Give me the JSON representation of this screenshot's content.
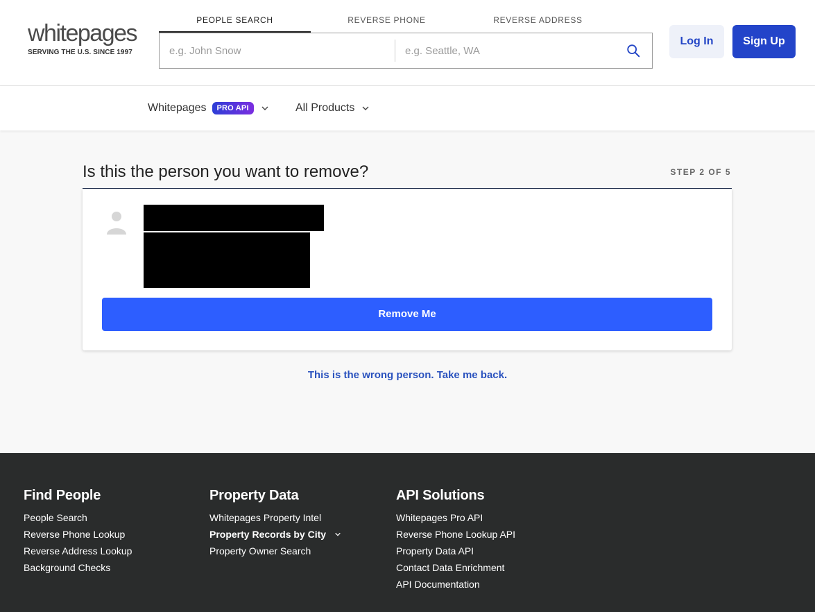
{
  "header": {
    "logo_text": "whitepages",
    "logo_tagline": "SERVING THE U.S. SINCE 1997",
    "tabs": [
      {
        "label": "PEOPLE SEARCH",
        "active": true
      },
      {
        "label": "REVERSE PHONE",
        "active": false
      },
      {
        "label": "REVERSE ADDRESS",
        "active": false
      }
    ],
    "name_placeholder": "e.g. John Snow",
    "location_placeholder": "e.g. Seattle, WA",
    "search_icon": "search-icon",
    "login_label": "Log In",
    "signup_label": "Sign Up"
  },
  "subnav": {
    "whitepages_label": "Whitepages",
    "pro_badge": "PRO API",
    "products_label": "All Products"
  },
  "main": {
    "title": "Is this the person you want to remove?",
    "step": "STEP 2 OF 5",
    "avatar_icon": "person-icon",
    "remove_label": "Remove Me",
    "back_link": "This is the wrong person. Take me back."
  },
  "footer": {
    "columns": [
      {
        "heading": "Find People",
        "links": [
          "People Search",
          "Reverse Phone Lookup",
          "Reverse Address Lookup",
          "Background Checks"
        ]
      },
      {
        "heading": "Property Data",
        "links": [
          "Whitepages Property Intel",
          "Property Records by City",
          "Property Owner Search"
        ]
      },
      {
        "heading": "API Solutions",
        "links": [
          "Whitepages Pro API",
          "Reverse Phone Lookup API",
          "Property Data API",
          "Contact Data Enrichment",
          "API Documentation"
        ]
      }
    ]
  },
  "colors": {
    "brand_blue": "#2344c9",
    "remove_blue": "#2d5eff",
    "link_blue": "#2a52be",
    "footer_bg": "#2a2c2c"
  }
}
